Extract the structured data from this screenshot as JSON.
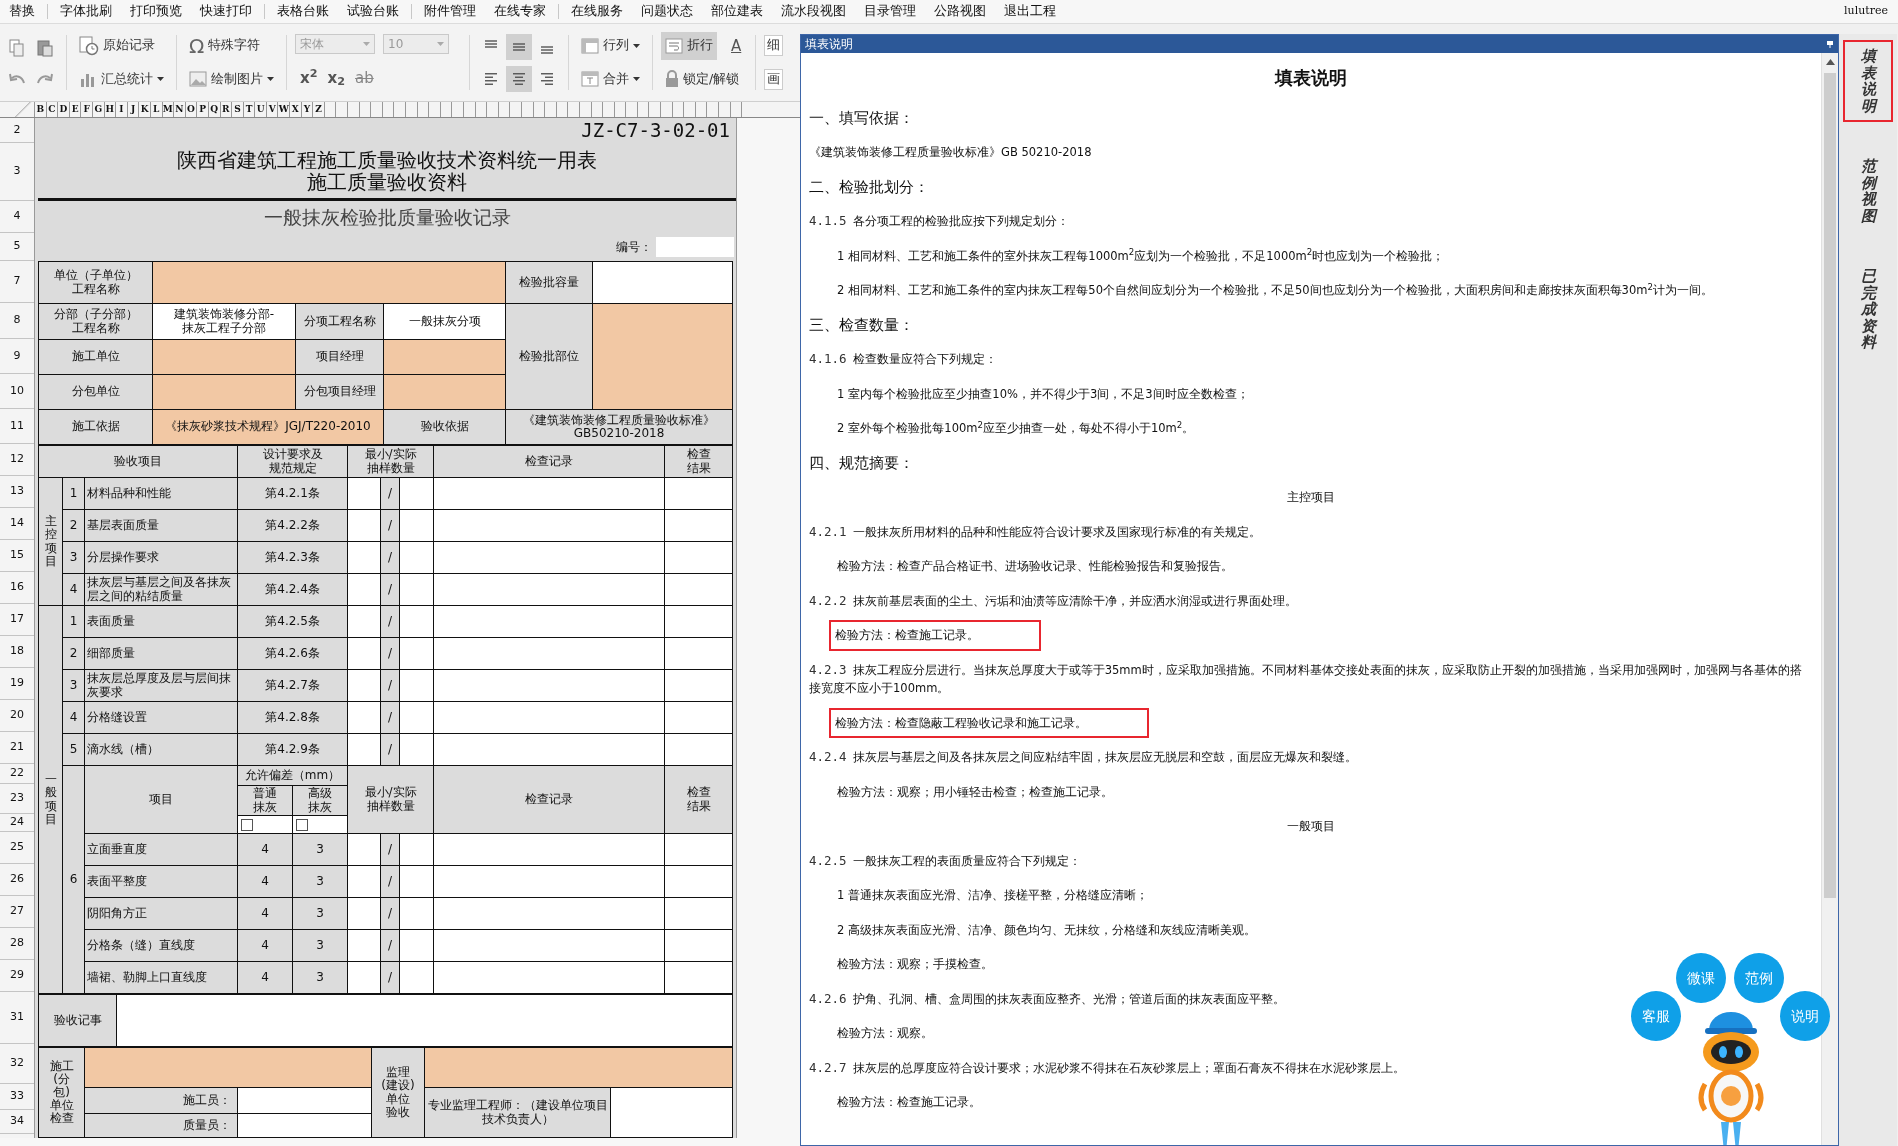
{
  "menu_bar": {
    "items": [
      "替换",
      "字体批刷",
      "打印预览",
      "快速打印",
      "表格台账",
      "试验台账",
      "附件管理",
      "在线专家",
      "在线服务",
      "问题状态",
      "部位建表",
      "流水段视图",
      "目录管理",
      "公路视图",
      "退出工程"
    ],
    "user": "lulutree"
  },
  "toolbar": {
    "record": "原始记录",
    "summary": "汇总统计",
    "special_chars_icon": "Ω",
    "special_chars": "特殊字符",
    "draw_picture": "绘制图片",
    "font": {
      "name": "宋体",
      "size": "10",
      "disabled": true
    },
    "superscript": "x$^{2}$",
    "subscript": "x$_{2}$",
    "strikethrough": "ab",
    "vertical_align": [
      {
        "selected": false
      },
      {
        "selected": true
      },
      {
        "selected": false
      }
    ],
    "horizontal_align": [
      {
        "selected": false
      },
      {
        "selected": true
      },
      {
        "selected": false
      }
    ],
    "rows_cols": "行列",
    "merge": "合并",
    "wrap": {
      "label": "折行",
      "selected": true
    },
    "font_color": "A",
    "lock": "锁定/解锁",
    "cut_labels": [
      "细",
      "画"
    ]
  },
  "column_headers": [
    "B",
    "C",
    "D",
    "E",
    "F",
    "G",
    "H",
    "I",
    "J",
    "K",
    "L",
    "M",
    "N",
    "O",
    "P",
    "Q",
    "R",
    "S",
    "T",
    "U",
    "V",
    "W",
    "X",
    "Y",
    "Z"
  ],
  "row_numbers": [
    "2",
    "3",
    "4",
    "5",
    "7",
    "8",
    "9",
    "10",
    "11",
    "12",
    "13",
    "14",
    "15",
    "16",
    "17",
    "18",
    "19",
    "20",
    "21",
    "22",
    "23",
    "24",
    "25",
    "26",
    "27",
    "28",
    "29",
    "31",
    "32",
    "33",
    "34"
  ],
  "form": {
    "code": "JZ-C7-3-02-01",
    "title": [
      "陕西省建筑工程施工质量验收技术资料统一用表",
      "施工质量验收资料"
    ],
    "subtitle": "一般抹灰检验批质量验收记录",
    "number_label": "编号：",
    "info": [
      [
        {
          "kind": "label",
          "text": "单位（子单位）工程名称"
        },
        {
          "kind": "input"
        },
        {
          "kind": "label",
          "text": "检验批容量"
        },
        {
          "kind": "blank"
        }
      ],
      [
        {
          "kind": "label",
          "text": "分部（子分部）工程名称"
        },
        {
          "kind": "value",
          "text": "建筑装饰装修分部-\n抹灰工程子分部"
        },
        {
          "kind": "label",
          "text": "分项工程名称"
        },
        {
          "kind": "value",
          "text": "一般抹灰分项"
        },
        {
          "kind": "label",
          "text": "检验批部位"
        },
        {
          "kind": "input"
        }
      ],
      [
        {
          "kind": "label",
          "text": "施工单位"
        },
        {
          "kind": "input"
        },
        {
          "kind": "label",
          "text": "项目经理"
        },
        {
          "kind": "input"
        }
      ],
      [
        {
          "kind": "label",
          "text": "分包单位"
        },
        {
          "kind": "input"
        },
        {
          "kind": "label",
          "text": "分包项目经理"
        },
        {
          "kind": "input"
        }
      ],
      [
        {
          "kind": "label",
          "text": "施工依据"
        },
        {
          "kind": "filled",
          "text": "《抹灰砂浆技术规程》JGJ/T220-2010"
        },
        {
          "kind": "label",
          "text": "验收依据"
        },
        {
          "kind": "label",
          "text": "《建筑装饰装修工程质量验收标准》\nGB50210-2018"
        }
      ]
    ],
    "items": {
      "header": [
        "验收项目",
        "设计要求及规范规定",
        "最小/实际抽样数量",
        "检查记录",
        "检查结果"
      ],
      "main_group": "主控项目",
      "main_rows": [
        {
          "no": "1",
          "name": "材料品种和性能",
          "clause": "第4.2.1条",
          "slash": "/"
        },
        {
          "no": "2",
          "name": "基层表面质量",
          "clause": "第4.2.2条",
          "slash": "/"
        },
        {
          "no": "3",
          "name": "分层操作要求",
          "clause": "第4.2.3条",
          "slash": "/"
        },
        {
          "no": "4",
          "name": "抹灰层与基层之间及各抹灰层之间的粘结质量",
          "clause": "第4.2.4条",
          "slash": "/"
        }
      ],
      "general_group": "一般项目",
      "general_rows": [
        {
          "no": "1",
          "name": "表面质量",
          "clause": "第4.2.5条",
          "slash": "/"
        },
        {
          "no": "2",
          "name": "细部质量",
          "clause": "第4.2.6条",
          "slash": "/"
        },
        {
          "no": "3",
          "name": "抹灰层总厚度及层与层间抹灰要求",
          "clause": "第4.2.7条",
          "slash": "/"
        },
        {
          "no": "4",
          "name": "分格缝设置",
          "clause": "第4.2.8条",
          "slash": "/"
        },
        {
          "no": "5",
          "name": "滴水线（槽）",
          "clause": "第4.2.9条",
          "slash": "/"
        }
      ],
      "tolerance": {
        "no": "6",
        "item": "项目",
        "tolerance": "允许偏差（mm）",
        "normal": "普通抹灰",
        "advanced": "高级抹灰",
        "sample": "最小/实际抽样数量",
        "record": "检查记录",
        "result": "检查结果",
        "normal_checked": false,
        "advanced_checked": false,
        "rows": [
          {
            "name": "立面垂直度",
            "normal": "4",
            "advanced": "3",
            "slash": "/"
          },
          {
            "name": "表面平整度",
            "normal": "4",
            "advanced": "3",
            "slash": "/"
          },
          {
            "name": "阴阳角方正",
            "normal": "4",
            "advanced": "3",
            "slash": "/"
          },
          {
            "name": "分格条（缝）直线度",
            "normal": "4",
            "advanced": "3",
            "slash": "/"
          },
          {
            "name": "墙裙、勒脚上口直线度",
            "normal": "4",
            "advanced": "3",
            "slash": "/"
          }
        ]
      }
    },
    "remarks_label": "验收记事",
    "signoff": {
      "contractor": "施工(分包)单位检查",
      "supervisor": "监理(建设)单位验收",
      "builder": "施工员：",
      "quality": "质量员：",
      "engineer": "专业监理工程师：（建设单位项目技术负责人）"
    }
  },
  "panel": {
    "title": "填表说明",
    "heading": "填表说明",
    "paragraphs": [
      {
        "kind": "section",
        "text": "一、填写依据："
      },
      {
        "kind": "text",
        "text": "《建筑装饰装修工程质量验收标准》GB 50210-2018"
      },
      {
        "kind": "section",
        "text": "二、检验批划分："
      },
      {
        "kind": "clause",
        "number": "4.1.5",
        "text": "各分项工程的检验批应按下列规定划分："
      },
      {
        "kind": "item",
        "number": "1",
        "text": "相同材料、工艺和施工条件的室外抹灰工程每1000m$^{2}$应划为一个检验批，不足1000m$^{2}$时也应划为一个检验批；"
      },
      {
        "kind": "item",
        "number": "2",
        "text": "相同材料、工艺和施工条件的室内抹灰工程每50个自然间应划分为一个检验批，不足50间也应划分为一个检验批，大面积房间和走廊按抹灰面积每30m$^{2}$计为一间。"
      },
      {
        "kind": "section",
        "text": "三、检查数量："
      },
      {
        "kind": "clause",
        "number": "4.1.6",
        "text": "检查数量应符合下列规定："
      },
      {
        "kind": "item",
        "number": "1",
        "text": "室内每个检验批应至少抽查10%，并不得少于3间，不足3间时应全数检查；"
      },
      {
        "kind": "item",
        "number": "2",
        "text": "室外每个检验批每100m$^{2}$应至少抽查一处，每处不得小于10m$^{2}$。"
      },
      {
        "kind": "section",
        "text": "四、规范摘要："
      },
      {
        "kind": "center",
        "text": "主控项目"
      },
      {
        "kind": "clause",
        "number": "4.2.1",
        "text": "一般抹灰所用材料的品种和性能应符合设计要求及国家现行标准的有关规定。"
      },
      {
        "kind": "method",
        "text": "检验方法：检查产品合格证书、进场验收记录、性能检验报告和复验报告。",
        "highlighted": false
      },
      {
        "kind": "clause",
        "number": "4.2.2",
        "text": "抹灰前基层表面的尘土、污垢和油渍等应清除干净，并应洒水润湿或进行界面处理。"
      },
      {
        "kind": "method",
        "text": "检验方法：检查施工记录。",
        "highlighted": true
      },
      {
        "kind": "clause",
        "number": "4.2.3",
        "text": "抹灰工程应分层进行。当抹灰总厚度大于或等于35mm时，应采取加强措施。不同材料基体交接处表面的抹灰，应采取防止开裂的加强措施，当采用加强网时，加强网与各基体的搭接宽度不应小于100mm。"
      },
      {
        "kind": "method",
        "text": "检验方法：检查隐蔽工程验收记录和施工记录。",
        "highlighted": true
      },
      {
        "kind": "clause",
        "number": "4.2.4",
        "text": "抹灰层与基层之间及各抹灰层之间应粘结牢固，抹灰层应无脱层和空鼓，面层应无爆灰和裂缝。"
      },
      {
        "kind": "method",
        "text": "检验方法：观察；用小锤轻击检查；检查施工记录。",
        "highlighted": false
      },
      {
        "kind": "center",
        "text": "一般项目"
      },
      {
        "kind": "clause",
        "number": "4.2.5",
        "text": "一般抹灰工程的表面质量应符合下列规定："
      },
      {
        "kind": "item",
        "number": "1",
        "text": "普通抹灰表面应光滑、洁净、接槎平整，分格缝应清晰；"
      },
      {
        "kind": "item",
        "number": "2",
        "text": "高级抹灰表面应光滑、洁净、颜色均匀、无抹纹，分格缝和灰线应清晰美观。"
      },
      {
        "kind": "method",
        "text": "检验方法：观察；手摸检查。",
        "highlighted": false
      },
      {
        "kind": "clause",
        "number": "4.2.6",
        "text": "护角、孔洞、槽、盒周围的抹灰表面应整齐、光滑；管道后面的抹灰表面应平整。"
      },
      {
        "kind": "method",
        "text": "检验方法：观察。",
        "highlighted": false
      },
      {
        "kind": "clause",
        "number": "4.2.7",
        "text": "抹灰层的总厚度应符合设计要求；水泥砂浆不得抹在石灰砂浆层上；罩面石膏灰不得抹在水泥砂浆层上。"
      },
      {
        "kind": "method",
        "text": "检验方法：检查施工记录。",
        "highlighted": false
      }
    ]
  },
  "assistant": {
    "buttons": [
      "微课",
      "范例",
      "客服",
      "说明"
    ]
  },
  "side_tabs": [
    {
      "label": "填表说明",
      "selected": true
    },
    {
      "label": "范例视图",
      "selected": false
    },
    {
      "label": "已完成资料",
      "selected": false
    }
  ]
}
